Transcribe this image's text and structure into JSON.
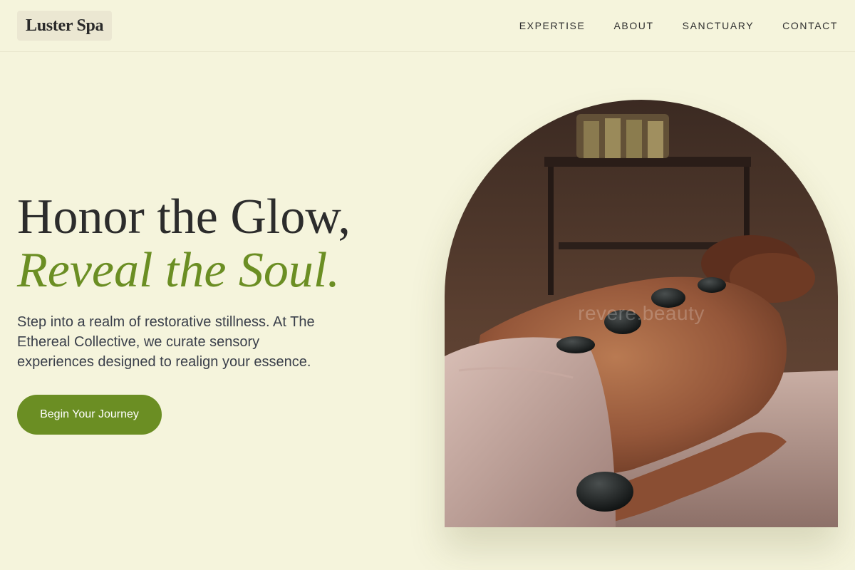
{
  "brand": {
    "name": "Luster Spa"
  },
  "nav": {
    "items": [
      "EXPERTISE",
      "ABOUT",
      "SANCTUARY",
      "CONTACT"
    ]
  },
  "hero": {
    "title_line1": "Honor the Glow,",
    "title_line2": "Reveal the Soul.",
    "description": "Step into a realm of restorative stillness. At The Ethereal Collective, we curate sensory experiences designed to realign your essence.",
    "cta_label": "Begin Your Journey"
  },
  "image": {
    "subject": "hot-stone-massage-photo",
    "watermark": "revere.beauty"
  },
  "colors": {
    "background": "#f5f4dc",
    "accent": "#6b8e23",
    "text": "#2c2c2c"
  }
}
